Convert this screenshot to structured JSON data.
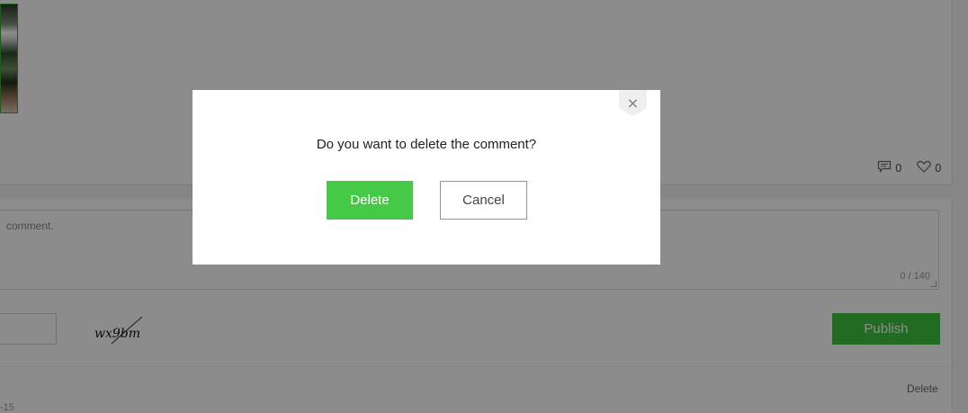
{
  "post": {
    "comment_count": "0",
    "like_count": "0"
  },
  "comment_form": {
    "placeholder": "comment.",
    "counter": "0 / 140",
    "captcha_text": "wx9bm",
    "publish_label": "Publish"
  },
  "comment_item": {
    "delete_label": "Delete",
    "date_fragment": "-15"
  },
  "dialog": {
    "message": "Do you want to delete the comment?",
    "confirm_label": "Delete",
    "cancel_label": "Cancel",
    "close_glyph": "×"
  },
  "colors": {
    "accent_green": "#46c946",
    "overlay": "rgba(0,0,0,0.45)"
  },
  "icons": {
    "comment": "comment-bubble-icon",
    "like": "heart-icon",
    "close": "close-icon"
  }
}
